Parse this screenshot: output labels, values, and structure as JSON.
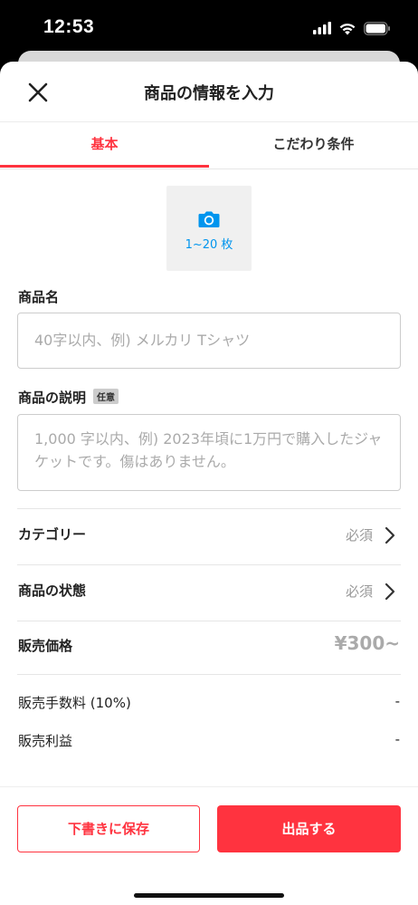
{
  "status_bar": {
    "time": "12:53",
    "icons": [
      "signal-icon",
      "wifi-icon",
      "battery-icon"
    ]
  },
  "header": {
    "title": "商品の情報を入力",
    "close_icon": "close-icon"
  },
  "tabs": [
    {
      "label": "基本",
      "active": true
    },
    {
      "label": "こだわり条件",
      "active": false
    }
  ],
  "photo": {
    "icon": "camera-icon",
    "count_label": "1~20 枚"
  },
  "fields": {
    "name_label": "商品名",
    "name_placeholder": "40字以内、例) メルカリ Tシャツ",
    "description_label": "商品の説明",
    "optional_badge": "任意",
    "description_placeholder": "1,000 字以内、例) 2023年頃に1万円で購入したジャケットです。傷はありません。"
  },
  "rows": {
    "category_label": "カテゴリー",
    "category_value": "必須",
    "condition_label": "商品の状態",
    "condition_value": "必須",
    "price_label": "販売価格",
    "price_value": "¥300~",
    "fee_label": "販売手数料 (10%)",
    "fee_value": "-",
    "profit_label": "販売利益",
    "profit_value": "-"
  },
  "footer": {
    "draft_button": "下書きに保存",
    "list_button": "出品する"
  },
  "colors": {
    "accent": "#ff333f",
    "link": "#0095ee"
  }
}
